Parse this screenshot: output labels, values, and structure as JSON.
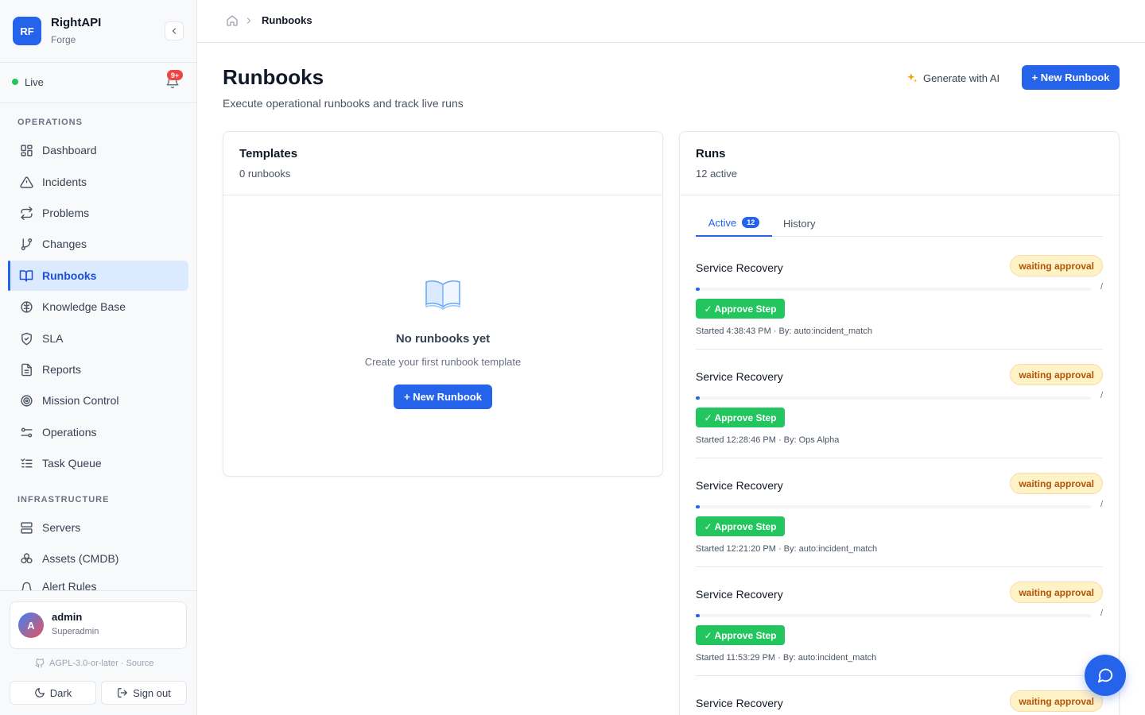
{
  "brand": {
    "initials": "RF",
    "name": "RightAPI",
    "sub": "Forge"
  },
  "status": {
    "live_label": "Live",
    "notif_count": "9+"
  },
  "nav": {
    "operations_label": "OPERATIONS",
    "infrastructure_label": "INFRASTRUCTURE",
    "operations": [
      {
        "label": "Dashboard",
        "icon": "dashboard-icon"
      },
      {
        "label": "Incidents",
        "icon": "warning-icon"
      },
      {
        "label": "Problems",
        "icon": "repeat-icon"
      },
      {
        "label": "Changes",
        "icon": "git-branch-icon"
      },
      {
        "label": "Runbooks",
        "icon": "book-icon",
        "active": true
      },
      {
        "label": "Knowledge Base",
        "icon": "brain-icon"
      },
      {
        "label": "SLA",
        "icon": "shield-icon"
      },
      {
        "label": "Reports",
        "icon": "report-icon"
      },
      {
        "label": "Mission Control",
        "icon": "target-icon"
      },
      {
        "label": "Operations",
        "icon": "sliders-icon"
      },
      {
        "label": "Task Queue",
        "icon": "list-icon"
      }
    ],
    "infrastructure": [
      {
        "label": "Servers",
        "icon": "server-icon"
      },
      {
        "label": "Assets (CMDB)",
        "icon": "boxes-icon"
      },
      {
        "label": "Alert Rules",
        "icon": "bell-icon"
      }
    ]
  },
  "user": {
    "initial": "A",
    "name": "admin",
    "role": "Superadmin"
  },
  "footer": {
    "license": "AGPL-3.0-or-later · Source",
    "dark_label": "Dark",
    "signout_label": "Sign out"
  },
  "breadcrumb": {
    "current": "Runbooks"
  },
  "page": {
    "title": "Runbooks",
    "subtitle": "Execute operational runbooks and track live runs",
    "generate_label": "Generate with AI",
    "new_label": "+ New Runbook"
  },
  "templates": {
    "title": "Templates",
    "count": "0 runbooks",
    "empty_title": "No runbooks yet",
    "empty_desc": "Create your first runbook template",
    "empty_button": "+ New Runbook"
  },
  "runs": {
    "title": "Runs",
    "count": "12 active",
    "tab_active": "Active",
    "tab_active_count": "12",
    "tab_history": "History",
    "items": [
      {
        "name": "Service Recovery",
        "status": "waiting approval",
        "progress_pct": 1,
        "slash": "/",
        "action": "✓ Approve Step",
        "meta": "Started 4:38:43 PM · By: auto:incident_match"
      },
      {
        "name": "Service Recovery",
        "status": "waiting approval",
        "progress_pct": 1,
        "slash": "/",
        "action": "✓ Approve Step",
        "meta": "Started 12:28:46 PM · By: Ops Alpha"
      },
      {
        "name": "Service Recovery",
        "status": "waiting approval",
        "progress_pct": 1,
        "slash": "/",
        "action": "✓ Approve Step",
        "meta": "Started 12:21:20 PM · By: auto:incident_match"
      },
      {
        "name": "Service Recovery",
        "status": "waiting approval",
        "progress_pct": 1,
        "slash": "/",
        "action": "✓ Approve Step",
        "meta": "Started 11:53:29 PM · By: auto:incident_match"
      },
      {
        "name": "Service Recovery",
        "status": "waiting approval"
      }
    ]
  },
  "colors": {
    "accent": "#2563eb",
    "success": "#22c55e",
    "warning_bg": "#fef3c7",
    "warning_text": "#b45309"
  }
}
